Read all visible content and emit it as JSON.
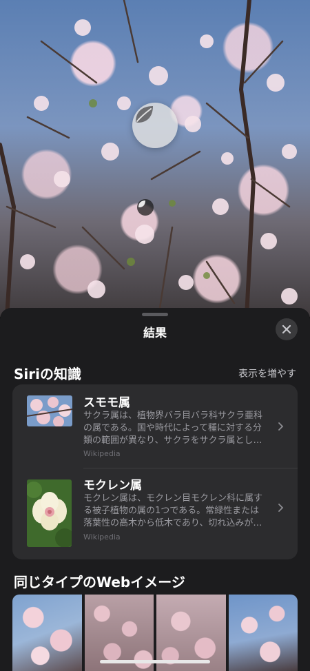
{
  "sheet": {
    "title": "結果",
    "close_icon": "xmark-icon"
  },
  "siri_knowledge": {
    "heading": "Siriの知識",
    "more_label": "表示を増やす",
    "results": [
      {
        "name": "スモモ属",
        "description": "サクラ属は、植物界バラ目バラ科サクラ亜科の属である。国や時代によって種に対する分類の範囲が異なり、サクラをサクラ属とし…",
        "source": "Wikipedia",
        "thumbnail": "cherry-blossom-thumbnail"
      },
      {
        "name": "モクレン属",
        "description": "モクレン属は、モクレン目モクレン科に属する被子植物の属の1つである。常緑性または落葉性の高木から低木であり、切れ込みが…",
        "source": "Wikipedia",
        "thumbnail": "magnolia-thumbnail"
      }
    ]
  },
  "web_images": {
    "heading": "同じタイプのWebイメージ",
    "count": 4
  },
  "colors": {
    "sheet_bg": "#1c1c1e",
    "card_bg": "#2c2c2e",
    "secondary_text": "#9a9aa0"
  }
}
